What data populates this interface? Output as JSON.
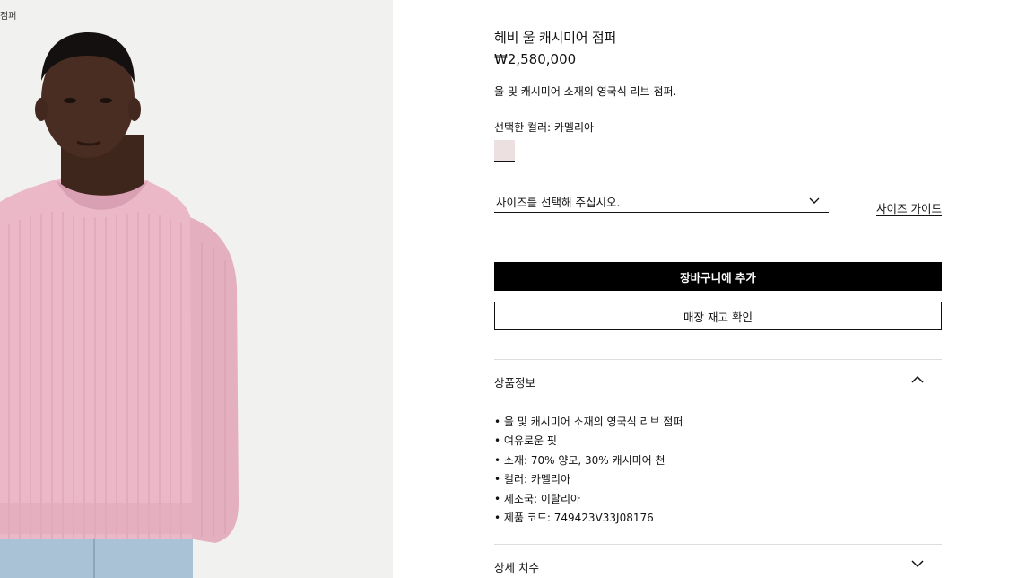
{
  "image_panel": {
    "caption": "점퍼",
    "colors": {
      "background": "#f1f1f0",
      "sweater": "#eab8c7",
      "skin": "#4a2d22"
    }
  },
  "product": {
    "title": "헤비 울 캐시미어 점퍼",
    "price": "₩2,580,000",
    "description": "울 및 캐시미어 소재의 영국식 리브 점퍼.",
    "color_label": "선택한 컬러: 카멜리아",
    "swatch_color": "#ece0e0"
  },
  "size": {
    "placeholder": "사이즈를 선택해 주십시오.",
    "guide_label": "사이즈 가이드"
  },
  "buttons": {
    "add_to_cart": "장바구니에 추가",
    "store_stock": "매장 재고 확인"
  },
  "accordion": {
    "product_info": {
      "title": "상품정보",
      "expanded": true,
      "items": [
        "울 및 캐시미어 소재의 영국식 리브 점퍼",
        "여유로운 핏",
        "소재: 70% 양모, 30% 캐시미어 천",
        "컬러: 카멜리아",
        "제조국: 이탈리아",
        "제품 코드: 749423V33J08176"
      ]
    },
    "detail_size": {
      "title": "상세 치수",
      "expanded": false
    }
  }
}
